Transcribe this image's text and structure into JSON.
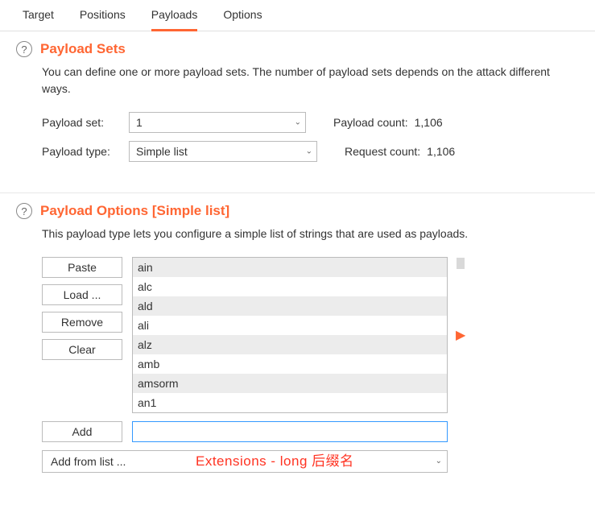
{
  "tabs": {
    "target": "Target",
    "positions": "Positions",
    "payloads": "Payloads",
    "options": "Options"
  },
  "sets": {
    "title": "Payload Sets",
    "desc": "You can define one or more payload sets. The number of payload sets depends on the attack different ways.",
    "set_label": "Payload set:",
    "set_value": "1",
    "type_label": "Payload type:",
    "type_value": "Simple list",
    "payload_count_label": "Payload count:",
    "payload_count_value": "1,106",
    "request_count_label": "Request count:",
    "request_count_value": "1,106"
  },
  "options": {
    "title": "Payload Options [Simple list]",
    "desc": "This payload type lets you configure a simple list of strings that are used as payloads.",
    "btn_paste": "Paste",
    "btn_load": "Load ...",
    "btn_remove": "Remove",
    "btn_clear": "Clear",
    "btn_add": "Add",
    "items": [
      "ain",
      "alc",
      "ald",
      "ali",
      "alz",
      "amb",
      "amsorm",
      "an1"
    ],
    "add_value": "",
    "preset_label": "Add from list ...",
    "annotation": "Extensions - long  后缀名"
  },
  "icons": {
    "help_glyph": "?",
    "chevron_down": "⌄",
    "right_triangle": "▶"
  }
}
